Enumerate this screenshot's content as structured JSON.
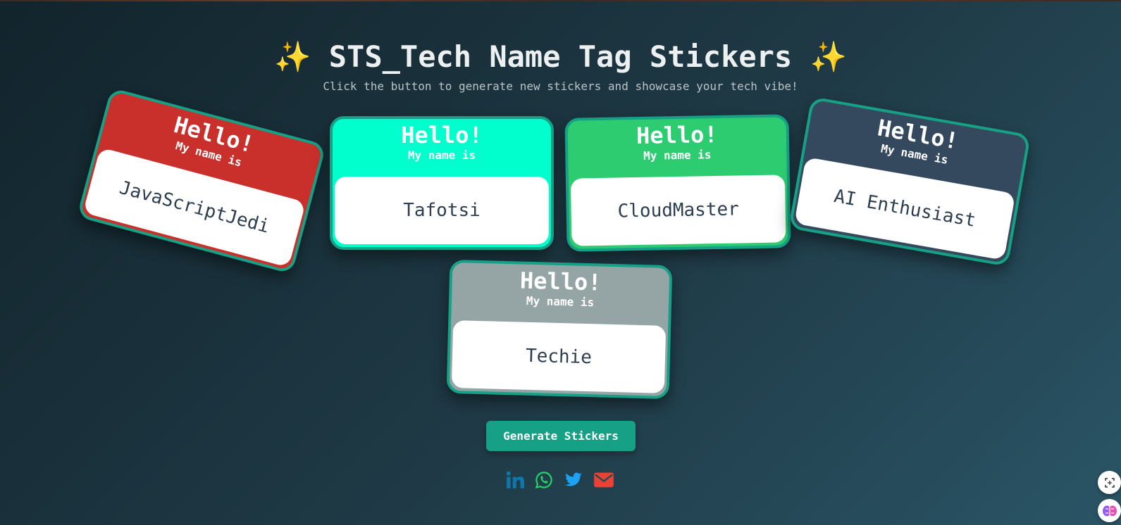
{
  "header": {
    "title": "✨ STS_Tech Name Tag Stickers ✨",
    "subtitle": "Click the button to generate new stickers and showcase your tech vibe!"
  },
  "stickers": [
    {
      "hello": "Hello!",
      "my_name_is": "My name is",
      "name": "JavaScriptJedi",
      "color": "#c9302c"
    },
    {
      "hello": "Hello!",
      "my_name_is": "My name is",
      "name": "Tafotsi",
      "color": "#00ffcc"
    },
    {
      "hello": "Hello!",
      "my_name_is": "My name is",
      "name": "CloudMaster",
      "color": "#2ecc71"
    },
    {
      "hello": "Hello!",
      "my_name_is": "My name is",
      "name": "AI Enthusiast",
      "color": "#34495e"
    },
    {
      "hello": "Hello!",
      "my_name_is": "My name is",
      "name": "Techie",
      "color": "#95a5a6"
    }
  ],
  "actions": {
    "generate_label": "Generate Stickers"
  },
  "social": [
    {
      "icon": "linkedin-icon",
      "color": "#0e76a8"
    },
    {
      "icon": "whatsapp-icon",
      "color": "#25d366"
    },
    {
      "icon": "twitter-icon",
      "color": "#1da1f2"
    },
    {
      "icon": "email-icon",
      "color": "#ea4335"
    }
  ],
  "colors": {
    "accent": "#16a085",
    "border": "#16a085",
    "background": "#1f3a46"
  }
}
